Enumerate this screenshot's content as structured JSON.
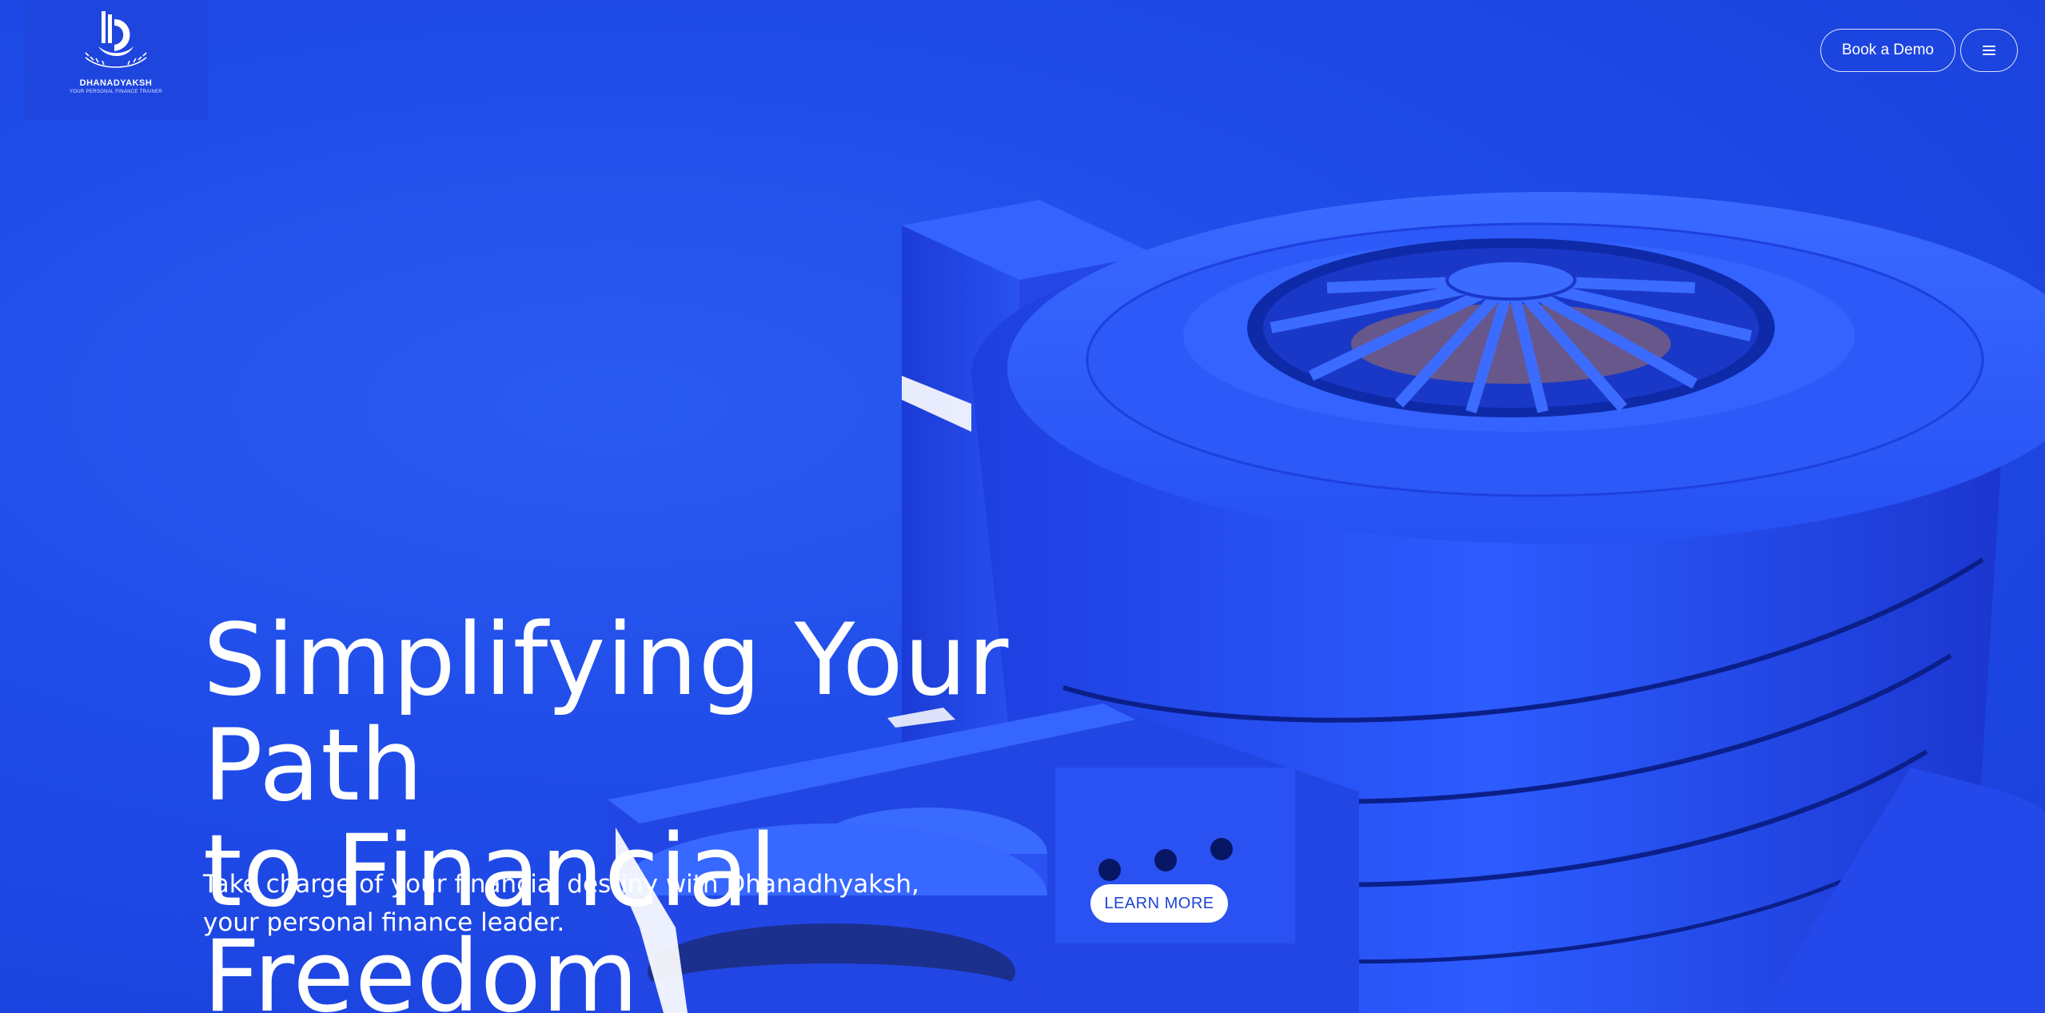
{
  "brand": {
    "name": "DHANADYAKSH",
    "tagline": "YOUR PERSONAL FINANCE TRAINER"
  },
  "nav": {
    "book_demo_label": "Book a Demo",
    "menu_icon": "hamburger-menu-icon"
  },
  "hero": {
    "headline_line1": "Simplifying Your Path",
    "headline_line2": "to Financial Freedom",
    "subtext_line1": "Take charge of your financial destiny with Dhanadhyaksh,",
    "subtext_line2": "your personal finance leader.",
    "cta_label": "LEARN MORE"
  },
  "colors": {
    "background": "#1f4fe6",
    "building": "#2453f2",
    "text": "#ffffff",
    "cta_text": "#1d44d8"
  }
}
